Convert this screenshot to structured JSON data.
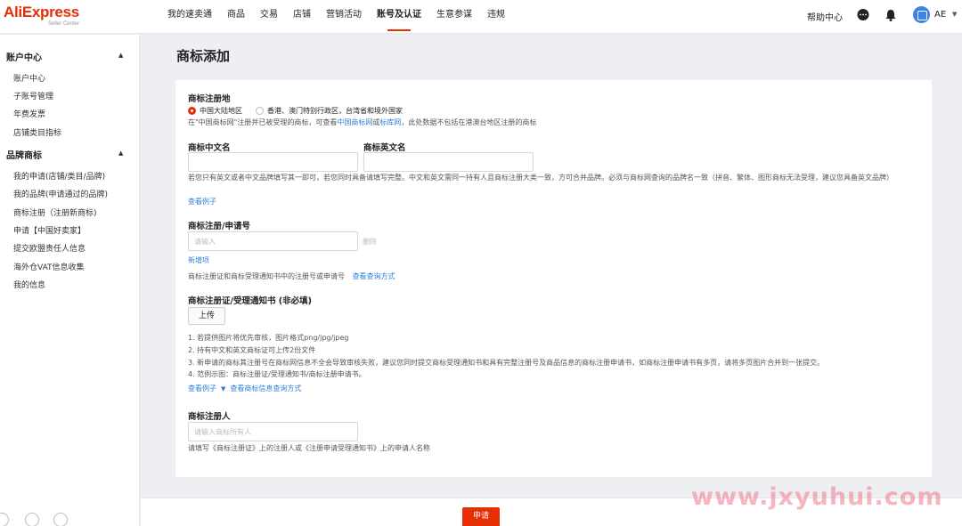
{
  "brand": {
    "name": "AliExpress",
    "sub": "Seller Center"
  },
  "nav": {
    "items": [
      "我的速卖通",
      "商品",
      "交易",
      "店铺",
      "营销活动",
      "账号及认证",
      "生意参谋",
      "违规"
    ],
    "active_index": 5,
    "help": "帮助中心",
    "user": "AE",
    "accent": "#e62e04"
  },
  "sidebar": {
    "groups": [
      {
        "title": "账户中心",
        "items": [
          "账户中心",
          "子账号管理",
          "年费发票",
          "店铺类目指标"
        ]
      },
      {
        "title": "品牌商标",
        "items": [
          "我的申请(店铺/类目/品牌)",
          "我的品牌(申请通过的品牌)",
          "商标注册（注册新商标)",
          "申请【中国好卖家】",
          "提交欧盟责任人信息",
          "海外仓VAT信息收集",
          "我的信息"
        ]
      }
    ]
  },
  "page": {
    "title": "商标添加"
  },
  "form": {
    "region": {
      "label": "商标注册地",
      "options": [
        "中国大陆地区",
        "香港、澳门特别行政区，台湾省和境外国家"
      ],
      "selected": 0,
      "hint_prefix": "在\"中国商标网\"注册并已被受理的商标，可查看",
      "hint_link1": "中国商标网",
      "hint_or": "或",
      "hint_link2": "标库网",
      "hint_suffix": "，此处数据不包括在港澳台地区注册的商标"
    },
    "name_cn": {
      "label": "商标中文名",
      "value": ""
    },
    "name_en": {
      "label": "商标英文名",
      "value": ""
    },
    "name_hint": "若您只有英文或者中文品牌填写其一即可，若您同时具备请填写完整。中文和英文需同一持有人且商标注册大类一致，方可合并品牌。必须与商标网查询的品牌名一致（拼音、繁体、图形商标无法受理，建议您具备英文品牌）",
    "name_example": "查看例子",
    "reg_no": {
      "label": "商标注册/申请号",
      "placeholder": "请输入",
      "delete": "删除",
      "add": "新增项",
      "hint": "商标注册证和商标受理通知书中的注册号或申请号",
      "hint_link": "查看查询方式"
    },
    "certificate": {
      "label": "商标注册证/受理通知书 (非必填)",
      "upload": "上传",
      "notes": [
        "1. 若提供图片将优先审核，图片格式png/jpg/jpeg",
        "2. 持有中文和英文商标证可上传2份文件",
        "3. 新申请的商标其注册号在商标网信息不全会导致审核失败，建议您同时提交商标受理通知书和具有完整注册号及商品信息的商标注册申请书，如商标注册申请书有多页，请将多页图片合并到一张提交。",
        "4. 范例示图：商标注册证/受理通知书/商标注册申请书。"
      ],
      "link1": "查看例子",
      "link2": "查看商标信息查询方式"
    },
    "registrant": {
      "label": "商标注册人",
      "placeholder": "请输入商标所有人",
      "hint": "请填写《商标注册证》上的注册人或《注册申请受理通知书》上的申请人名称"
    }
  },
  "footer": {
    "submit": "申请"
  },
  "watermark": "www.jxyuhui.com"
}
